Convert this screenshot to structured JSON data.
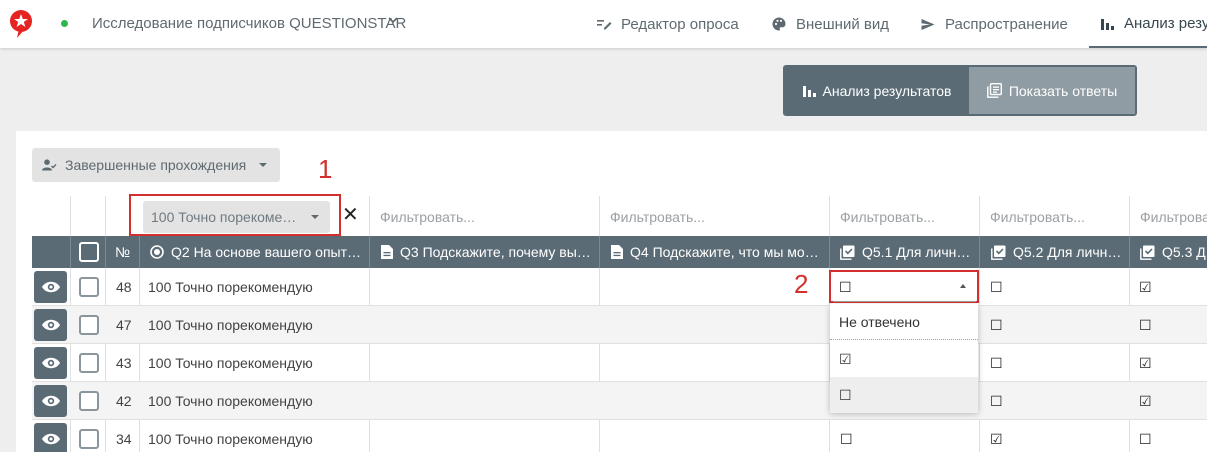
{
  "nav": {
    "survey_title": "Исследование подписчиков QUESTIONSTAR",
    "tabs": [
      {
        "label": "Редактор опроса",
        "icon": "edit-icon"
      },
      {
        "label": "Внешний вид",
        "icon": "palette-icon"
      },
      {
        "label": "Распространение",
        "icon": "send-icon"
      },
      {
        "label": "Анализ резу",
        "icon": "bar-chart-icon",
        "active": true
      }
    ]
  },
  "view_toggle": {
    "analysis_label": "Анализ результатов",
    "answers_label": "Показать ответы"
  },
  "filter": {
    "completed_label": "Завершенные прохождения"
  },
  "annotations": {
    "one": "1",
    "two": "2"
  },
  "column_filters": {
    "q2_value": "100 Точно порекоме…",
    "placeholder": "Фильтровать...",
    "placeholder_cut": "Фильтрова"
  },
  "columns": {
    "num": "№",
    "q2": "Q2 На основе вашего опыт…",
    "q3": "Q3 Подскажите, почему вы…",
    "q4": "Q4 Подскажите, что мы мо…",
    "q51": "Q5.1 Для личн…",
    "q52": "Q5.2 Для личн…",
    "q53": "Q5.3 Д"
  },
  "rows": [
    {
      "num": "48",
      "q2": "100 Точно порекомендую",
      "q51": "☐",
      "q52": "☐",
      "q53": "☑"
    },
    {
      "num": "47",
      "q2": "100 Точно порекомендую",
      "q51": "",
      "q52": "☐",
      "q53": "☐"
    },
    {
      "num": "43",
      "q2": "100 Точно порекомендую",
      "q51": "",
      "q52": "☐",
      "q53": "☑"
    },
    {
      "num": "42",
      "q2": "100 Точно порекомендую",
      "q51": "",
      "q52": "☐",
      "q53": "☑"
    },
    {
      "num": "34",
      "q2": "100 Точно порекомендую",
      "q51": "☐",
      "q52": "☑",
      "q53": "☐"
    }
  ],
  "dropdown": {
    "current": "☐",
    "options": [
      "Не отвечено",
      "☑",
      "☐"
    ]
  }
}
